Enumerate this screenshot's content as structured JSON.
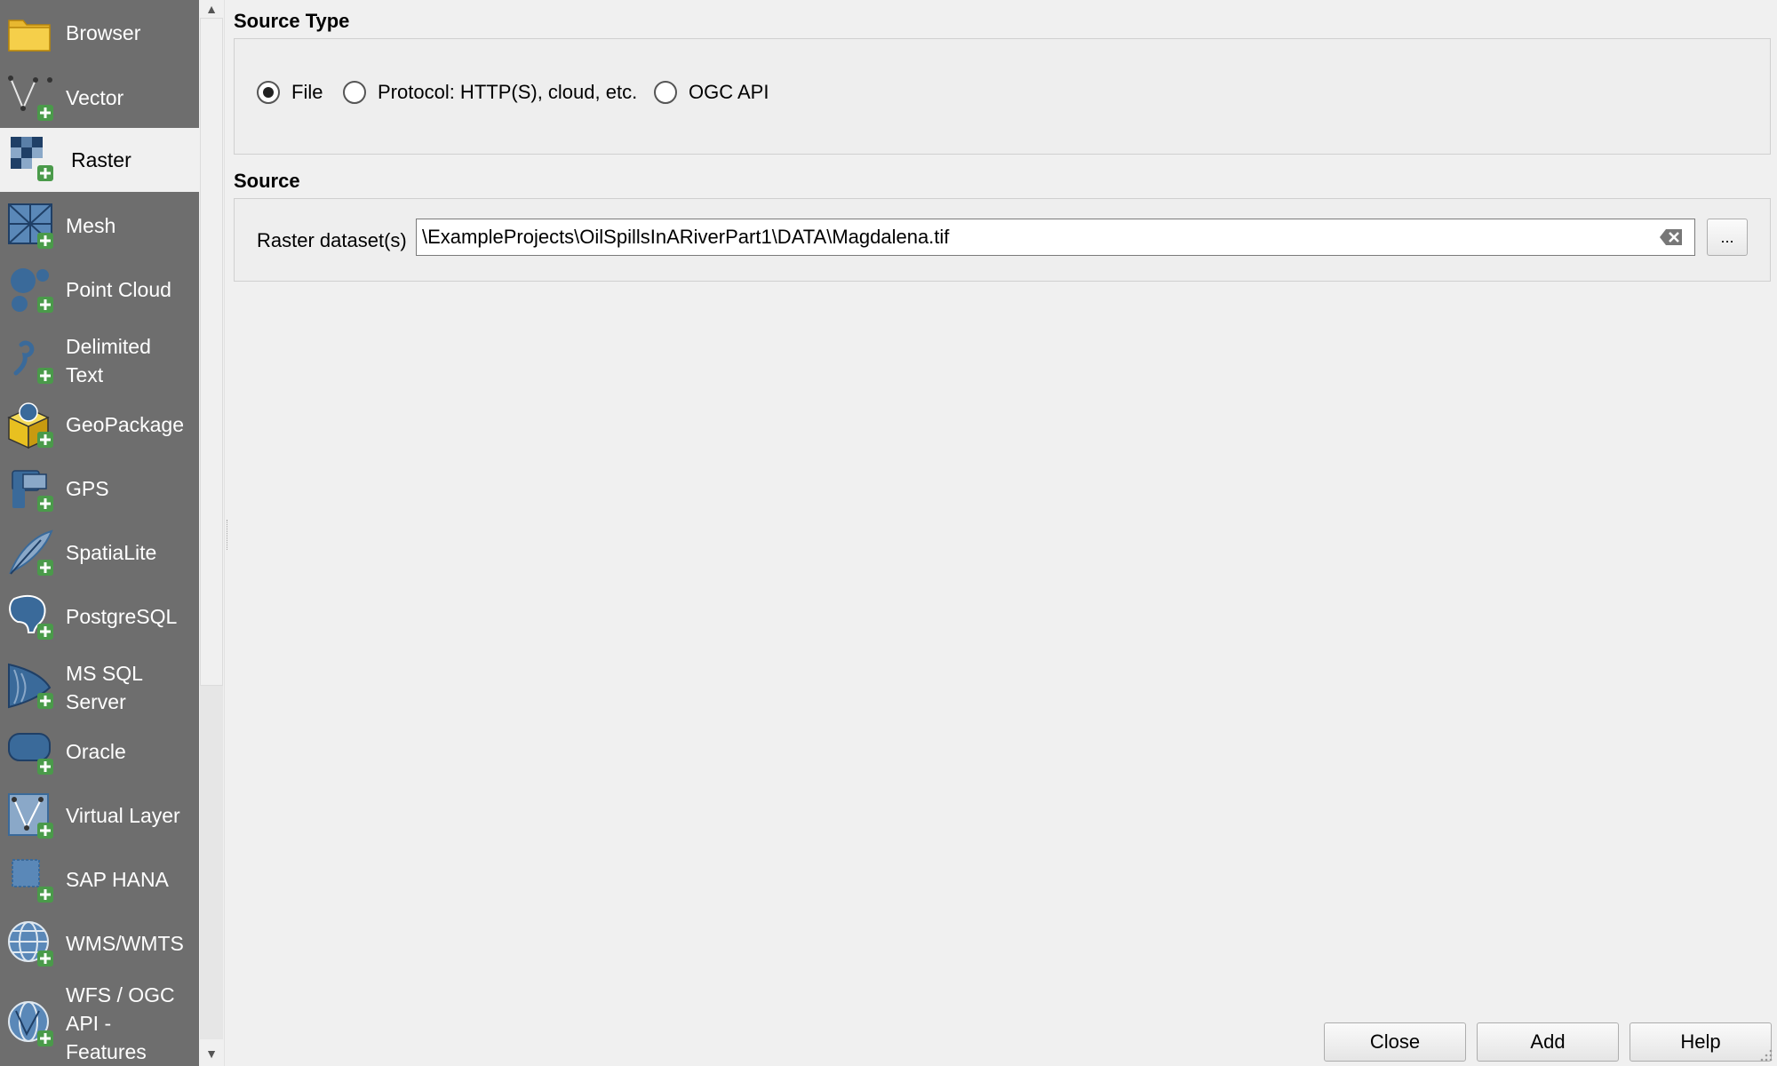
{
  "sidebar": {
    "items": [
      {
        "label": "Browser",
        "icon": "folder-icon"
      },
      {
        "label": "Vector",
        "icon": "vector-add-icon"
      },
      {
        "label": "Raster",
        "icon": "raster-add-icon",
        "active": true
      },
      {
        "label": "Mesh",
        "icon": "mesh-add-icon"
      },
      {
        "label": "Point Cloud",
        "icon": "point-cloud-add-icon"
      },
      {
        "label": "Delimited Text",
        "icon": "delimited-text-add-icon"
      },
      {
        "label": "GeoPackage",
        "icon": "geopackage-add-icon"
      },
      {
        "label": "GPS",
        "icon": "gps-add-icon"
      },
      {
        "label": "SpatiaLite",
        "icon": "spatialite-add-icon"
      },
      {
        "label": "PostgreSQL",
        "icon": "postgresql-add-icon"
      },
      {
        "label": "MS SQL Server",
        "icon": "mssql-add-icon"
      },
      {
        "label": "Oracle",
        "icon": "oracle-add-icon"
      },
      {
        "label": "Virtual Layer",
        "icon": "virtual-layer-add-icon"
      },
      {
        "label": "SAP HANA",
        "icon": "sap-hana-add-icon"
      },
      {
        "label": "WMS/WMTS",
        "icon": "wms-add-icon"
      },
      {
        "label": "WFS / OGC API - Features",
        "icon": "wfs-add-icon"
      }
    ]
  },
  "source_type": {
    "title": "Source Type",
    "options": [
      {
        "label": "File",
        "selected": true
      },
      {
        "label": "Protocol: HTTP(S), cloud, etc.",
        "selected": false
      },
      {
        "label": "OGC API",
        "selected": false
      }
    ]
  },
  "source": {
    "title": "Source",
    "dataset_label": "Raster dataset(s)",
    "path_value": "\\ExampleProjects\\OilSpillsInARiverPart1\\DATA\\Magdalena.tif",
    "browse_label": "..."
  },
  "buttons": {
    "close": "Close",
    "add": "Add",
    "help": "Help"
  },
  "colors": {
    "sidebar_bg": "#6e6e6e",
    "icon_blue": "#3a6a9a",
    "plus_green": "#4a9a4a"
  }
}
